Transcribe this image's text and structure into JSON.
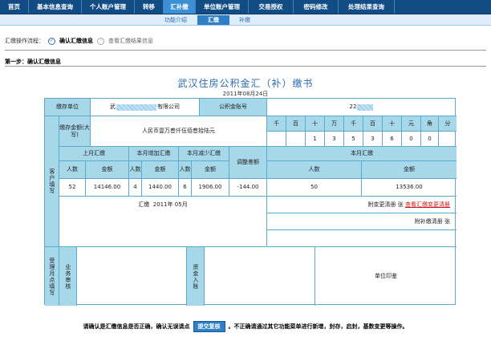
{
  "nav": {
    "items": [
      "首页",
      "基本信息查询",
      "个人账户管理",
      "转移",
      "汇补缴",
      "单位账户管理",
      "交易授权",
      "密码修改",
      "处理结果查询"
    ],
    "active_index": 4
  },
  "subnav": {
    "items": [
      "功能介绍",
      "汇缴",
      "补缴"
    ],
    "active_index": 1
  },
  "crumb": {
    "label": "汇缴操作流程：",
    "step1_icon": "check-circle-icon",
    "step1": "确认汇缴信息",
    "step2_icon": "circle-icon",
    "step2": "查看汇缴结果信息"
  },
  "step_title": "第一步：确认汇缴信息",
  "doc": {
    "title": "武汉住房公积金汇（补）缴书",
    "date": "2011年08月24日"
  },
  "form": {
    "unit_label": "缴存单位",
    "unit_value_prefix": "武",
    "unit_value_suffix": "有限公司",
    "account_label": "公积金账号",
    "account_value_prefix": "22",
    "amount_words_label": "缴存金额(大写)",
    "amount_words": "人民币壹万叁仟伍佰叁拾陆元",
    "digit_headers": [
      "千",
      "百",
      "十",
      "万",
      "千",
      "百",
      "十",
      "元",
      "角",
      "分"
    ],
    "digit_values": [
      "",
      "",
      "1",
      "3",
      "5",
      "3",
      "6",
      "0",
      "0"
    ],
    "section_customer": "客户填写",
    "last_month": "上月汇缴",
    "this_increase": "本月增加汇缴",
    "this_decrease": "本月减少汇缴",
    "adjust": "调整差额",
    "this_month": "本月汇缴",
    "people": "人数",
    "amount": "金额",
    "last_people": "52",
    "last_amount": "14146.00",
    "inc_people": "4",
    "inc_amount": "1440.00",
    "dec_people": "6",
    "dec_amount": "1906.00",
    "adjust_value": "-144.00",
    "month_people": "50",
    "month_amount": "13536.00",
    "pay_month_label": "汇缴",
    "pay_month_value": "2011年 05月",
    "change_list_label": "附变更清册 张",
    "change_list_link": "查看汇缴变更清册",
    "supp_list_label": "附补缴清册 张",
    "section_receiver": "受理月点填写",
    "biz_review": "业务审核",
    "fund_in": "资金入账",
    "unit_seal": "单位印鉴"
  },
  "bottom": {
    "text_before": "请确认是汇缴信息是否正确，确认无误请点",
    "button": "提交复核",
    "text_after": "。不正确请通过其它功能菜单进行新增，封存，启封，基数变更等操作。"
  }
}
